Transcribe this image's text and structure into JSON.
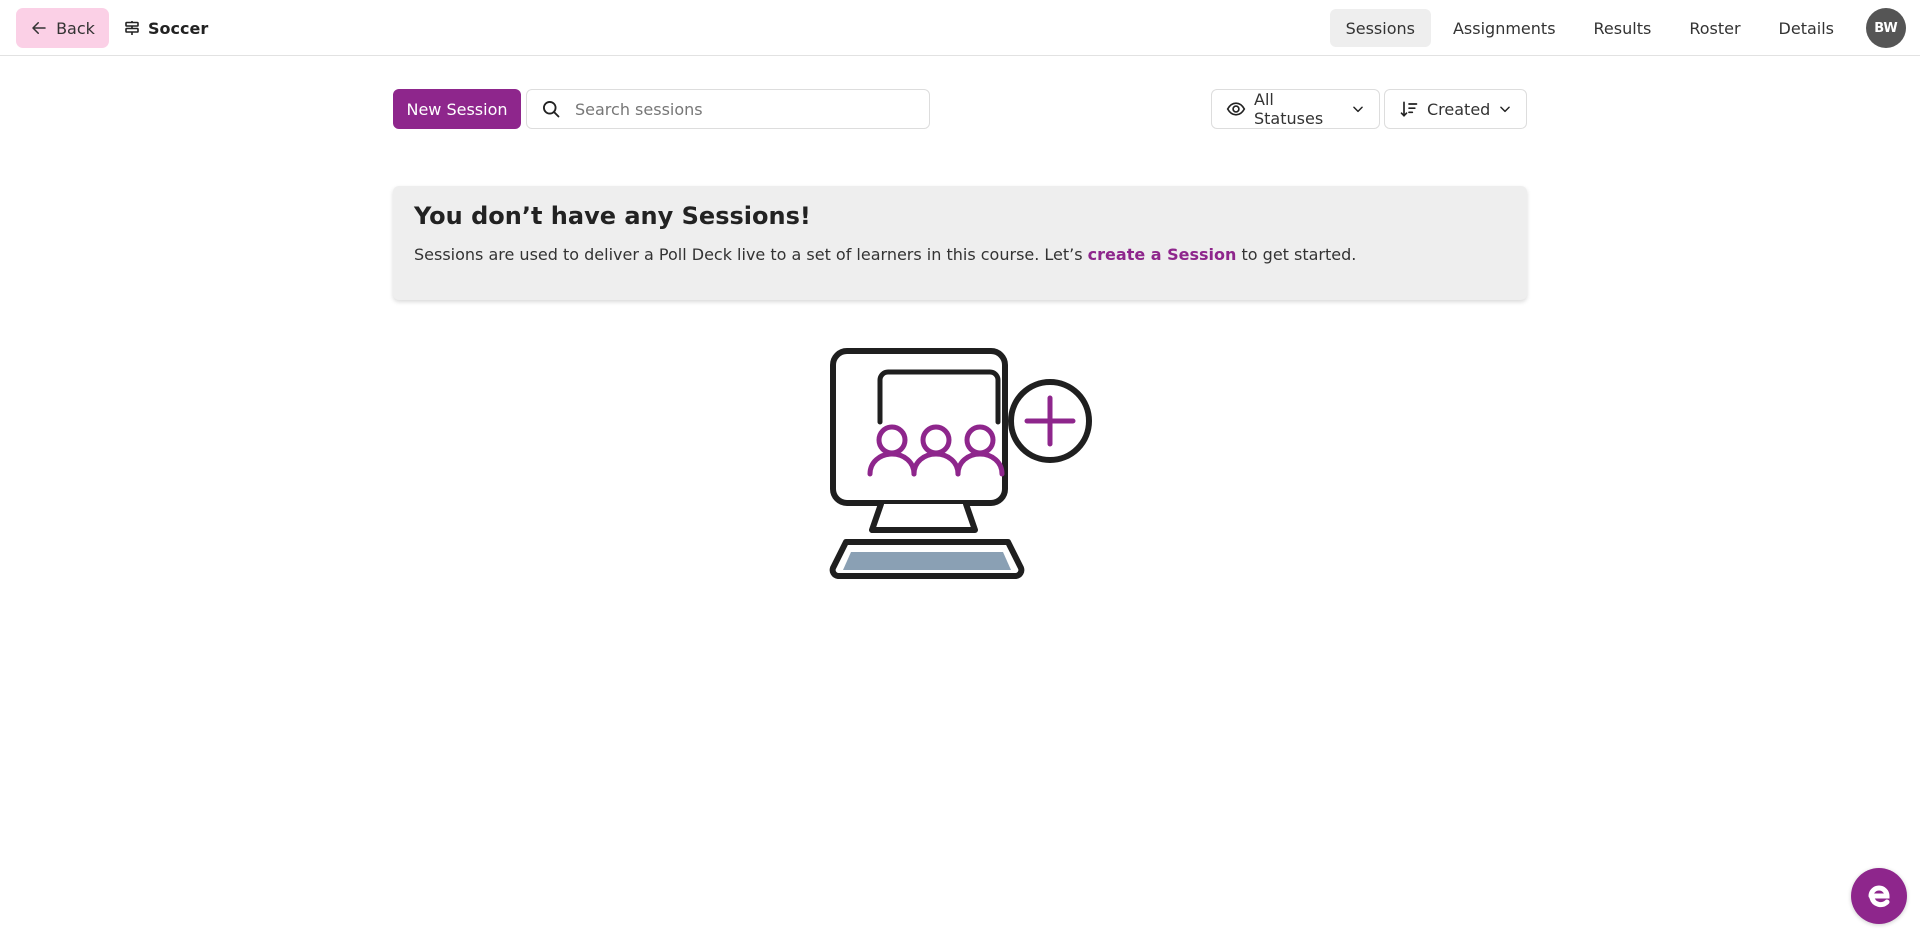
{
  "header": {
    "back_label": "Back",
    "back_icon": "arrow-left-icon",
    "course_icon": "signpost-icon",
    "course_name": "Soccer",
    "nav": [
      {
        "label": "Sessions",
        "active": true
      },
      {
        "label": "Assignments",
        "active": false
      },
      {
        "label": "Results",
        "active": false
      },
      {
        "label": "Roster",
        "active": false
      },
      {
        "label": "Details",
        "active": false
      }
    ],
    "avatar_initials": "BW"
  },
  "toolbar": {
    "new_session_label": "New Session",
    "search_placeholder": "Search sessions",
    "search_value": "",
    "status_filter_label": "All Statuses",
    "status_filter_icon": "eye-icon",
    "sort_label": "Created",
    "sort_icon": "sort-descending-icon"
  },
  "empty_state": {
    "title": "You don’t have any Sessions!",
    "text_before": "Sessions are used to deliver a Poll Deck live to a set of learners in this course. Let’s ",
    "link_text": "create a Session",
    "text_after": " to get started.",
    "illustration": "computer-with-learners-add-illustration"
  },
  "colors": {
    "brand": "#8e268c",
    "back_button_bg": "#fbd0e6",
    "card_bg": "#eeeeee",
    "avatar_bg": "#555555",
    "keyboard_fill": "#8aa0b4"
  },
  "chat_widget": {
    "icon": "chat-e-icon",
    "glyph": "e"
  }
}
